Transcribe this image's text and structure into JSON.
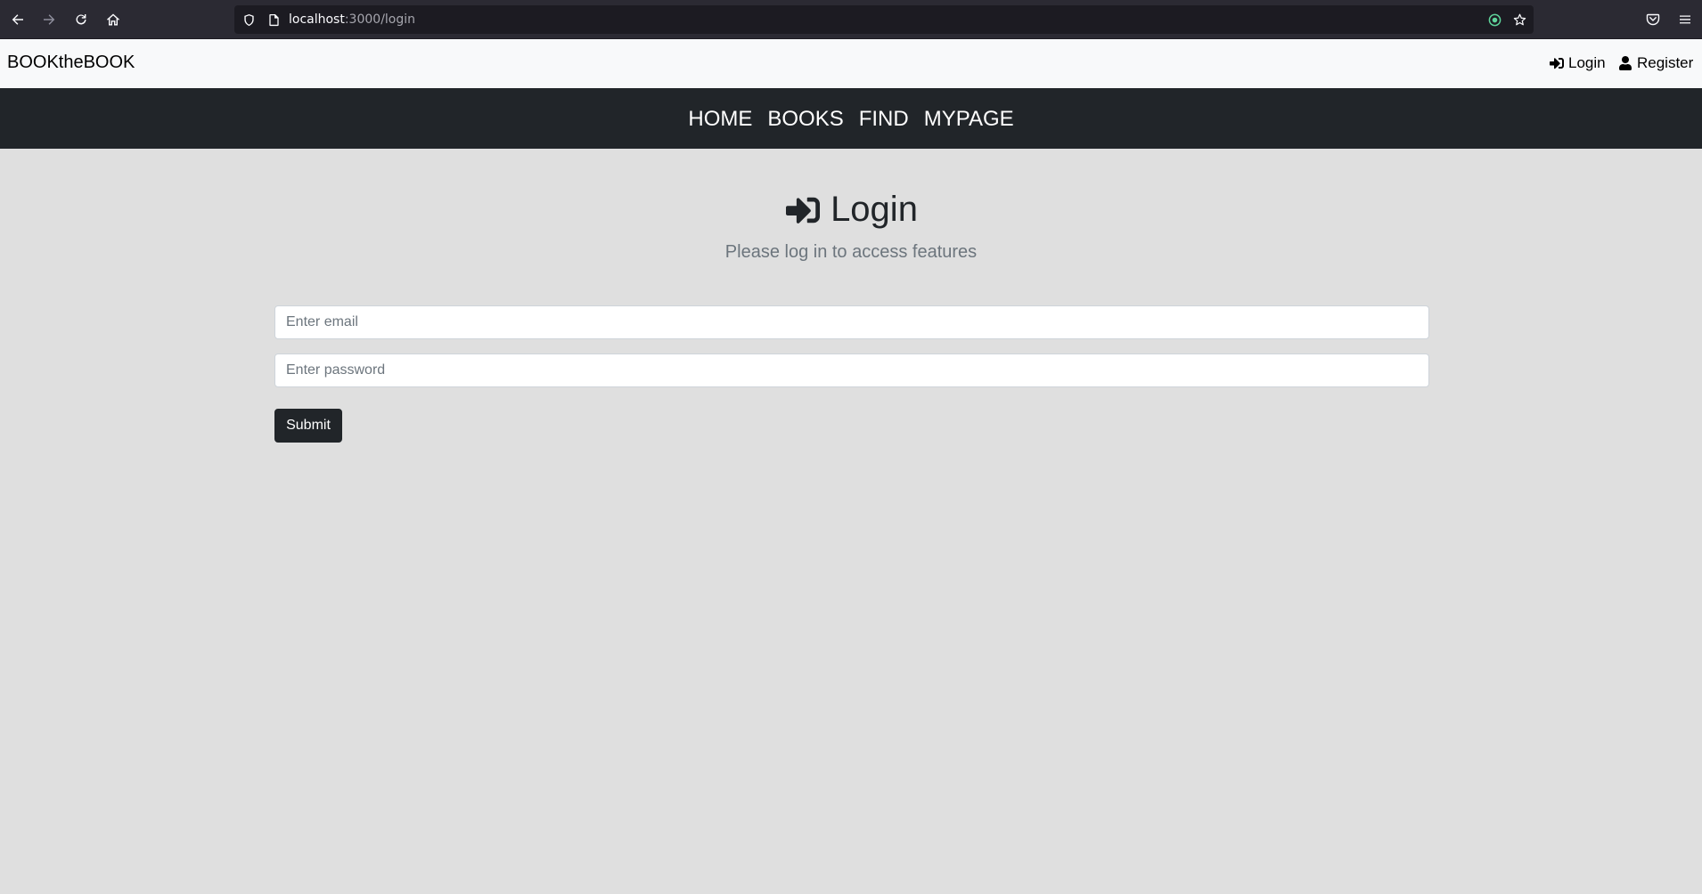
{
  "browser": {
    "url_host": "localhost",
    "url_path": ":3000/login",
    "icons": [
      "back-icon",
      "forward-icon",
      "reload-icon",
      "home-icon",
      "shield-icon",
      "page-icon",
      "extension-icon",
      "bookmark-star-icon",
      "pocket-icon",
      "menu-icon"
    ]
  },
  "topnav": {
    "brand": "BOOKtheBOOK",
    "login_label": "Login",
    "register_label": "Register"
  },
  "mainnav": {
    "items": [
      {
        "label": "HOME"
      },
      {
        "label": "BOOKS"
      },
      {
        "label": "FIND"
      },
      {
        "label": "MYPAGE"
      }
    ]
  },
  "login": {
    "title": "Login",
    "subtitle": "Please log in to access features",
    "email_placeholder": "Enter email",
    "email_value": "",
    "password_placeholder": "Enter password",
    "password_value": "",
    "submit_label": "Submit"
  }
}
